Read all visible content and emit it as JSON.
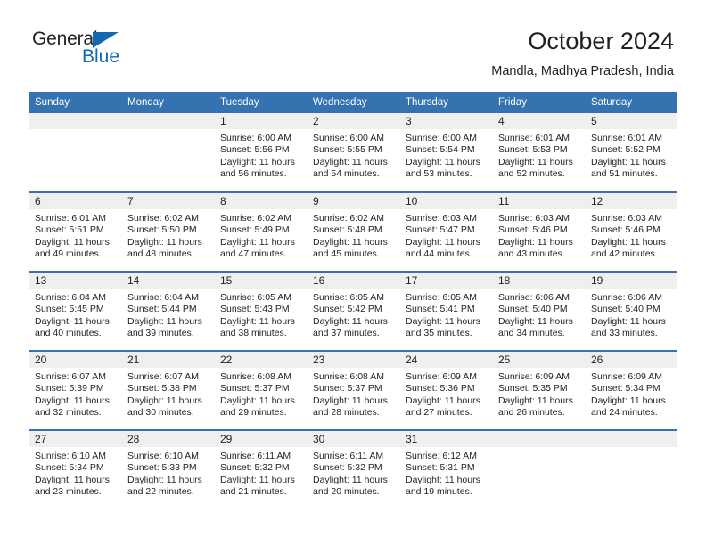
{
  "brand": {
    "name_part1": "General",
    "name_part2": "Blue",
    "accent_color": "#1268b3"
  },
  "header": {
    "month_title": "October 2024",
    "location": "Mandla, Madhya Pradesh, India"
  },
  "theme": {
    "header_blue": "#3572b0",
    "day_band_gray": "#efefef",
    "text_color": "#231f20"
  },
  "calendar": {
    "weekdays": [
      "Sunday",
      "Monday",
      "Tuesday",
      "Wednesday",
      "Thursday",
      "Friday",
      "Saturday"
    ],
    "weeks": [
      [
        {
          "day": "",
          "lines": []
        },
        {
          "day": "",
          "lines": []
        },
        {
          "day": "1",
          "lines": [
            "Sunrise: 6:00 AM",
            "Sunset: 5:56 PM",
            "Daylight: 11 hours",
            "and 56 minutes."
          ]
        },
        {
          "day": "2",
          "lines": [
            "Sunrise: 6:00 AM",
            "Sunset: 5:55 PM",
            "Daylight: 11 hours",
            "and 54 minutes."
          ]
        },
        {
          "day": "3",
          "lines": [
            "Sunrise: 6:00 AM",
            "Sunset: 5:54 PM",
            "Daylight: 11 hours",
            "and 53 minutes."
          ]
        },
        {
          "day": "4",
          "lines": [
            "Sunrise: 6:01 AM",
            "Sunset: 5:53 PM",
            "Daylight: 11 hours",
            "and 52 minutes."
          ]
        },
        {
          "day": "5",
          "lines": [
            "Sunrise: 6:01 AM",
            "Sunset: 5:52 PM",
            "Daylight: 11 hours",
            "and 51 minutes."
          ]
        }
      ],
      [
        {
          "day": "6",
          "lines": [
            "Sunrise: 6:01 AM",
            "Sunset: 5:51 PM",
            "Daylight: 11 hours",
            "and 49 minutes."
          ]
        },
        {
          "day": "7",
          "lines": [
            "Sunrise: 6:02 AM",
            "Sunset: 5:50 PM",
            "Daylight: 11 hours",
            "and 48 minutes."
          ]
        },
        {
          "day": "8",
          "lines": [
            "Sunrise: 6:02 AM",
            "Sunset: 5:49 PM",
            "Daylight: 11 hours",
            "and 47 minutes."
          ]
        },
        {
          "day": "9",
          "lines": [
            "Sunrise: 6:02 AM",
            "Sunset: 5:48 PM",
            "Daylight: 11 hours",
            "and 45 minutes."
          ]
        },
        {
          "day": "10",
          "lines": [
            "Sunrise: 6:03 AM",
            "Sunset: 5:47 PM",
            "Daylight: 11 hours",
            "and 44 minutes."
          ]
        },
        {
          "day": "11",
          "lines": [
            "Sunrise: 6:03 AM",
            "Sunset: 5:46 PM",
            "Daylight: 11 hours",
            "and 43 minutes."
          ]
        },
        {
          "day": "12",
          "lines": [
            "Sunrise: 6:03 AM",
            "Sunset: 5:46 PM",
            "Daylight: 11 hours",
            "and 42 minutes."
          ]
        }
      ],
      [
        {
          "day": "13",
          "lines": [
            "Sunrise: 6:04 AM",
            "Sunset: 5:45 PM",
            "Daylight: 11 hours",
            "and 40 minutes."
          ]
        },
        {
          "day": "14",
          "lines": [
            "Sunrise: 6:04 AM",
            "Sunset: 5:44 PM",
            "Daylight: 11 hours",
            "and 39 minutes."
          ]
        },
        {
          "day": "15",
          "lines": [
            "Sunrise: 6:05 AM",
            "Sunset: 5:43 PM",
            "Daylight: 11 hours",
            "and 38 minutes."
          ]
        },
        {
          "day": "16",
          "lines": [
            "Sunrise: 6:05 AM",
            "Sunset: 5:42 PM",
            "Daylight: 11 hours",
            "and 37 minutes."
          ]
        },
        {
          "day": "17",
          "lines": [
            "Sunrise: 6:05 AM",
            "Sunset: 5:41 PM",
            "Daylight: 11 hours",
            "and 35 minutes."
          ]
        },
        {
          "day": "18",
          "lines": [
            "Sunrise: 6:06 AM",
            "Sunset: 5:40 PM",
            "Daylight: 11 hours",
            "and 34 minutes."
          ]
        },
        {
          "day": "19",
          "lines": [
            "Sunrise: 6:06 AM",
            "Sunset: 5:40 PM",
            "Daylight: 11 hours",
            "and 33 minutes."
          ]
        }
      ],
      [
        {
          "day": "20",
          "lines": [
            "Sunrise: 6:07 AM",
            "Sunset: 5:39 PM",
            "Daylight: 11 hours",
            "and 32 minutes."
          ]
        },
        {
          "day": "21",
          "lines": [
            "Sunrise: 6:07 AM",
            "Sunset: 5:38 PM",
            "Daylight: 11 hours",
            "and 30 minutes."
          ]
        },
        {
          "day": "22",
          "lines": [
            "Sunrise: 6:08 AM",
            "Sunset: 5:37 PM",
            "Daylight: 11 hours",
            "and 29 minutes."
          ]
        },
        {
          "day": "23",
          "lines": [
            "Sunrise: 6:08 AM",
            "Sunset: 5:37 PM",
            "Daylight: 11 hours",
            "and 28 minutes."
          ]
        },
        {
          "day": "24",
          "lines": [
            "Sunrise: 6:09 AM",
            "Sunset: 5:36 PM",
            "Daylight: 11 hours",
            "and 27 minutes."
          ]
        },
        {
          "day": "25",
          "lines": [
            "Sunrise: 6:09 AM",
            "Sunset: 5:35 PM",
            "Daylight: 11 hours",
            "and 26 minutes."
          ]
        },
        {
          "day": "26",
          "lines": [
            "Sunrise: 6:09 AM",
            "Sunset: 5:34 PM",
            "Daylight: 11 hours",
            "and 24 minutes."
          ]
        }
      ],
      [
        {
          "day": "27",
          "lines": [
            "Sunrise: 6:10 AM",
            "Sunset: 5:34 PM",
            "Daylight: 11 hours",
            "and 23 minutes."
          ]
        },
        {
          "day": "28",
          "lines": [
            "Sunrise: 6:10 AM",
            "Sunset: 5:33 PM",
            "Daylight: 11 hours",
            "and 22 minutes."
          ]
        },
        {
          "day": "29",
          "lines": [
            "Sunrise: 6:11 AM",
            "Sunset: 5:32 PM",
            "Daylight: 11 hours",
            "and 21 minutes."
          ]
        },
        {
          "day": "30",
          "lines": [
            "Sunrise: 6:11 AM",
            "Sunset: 5:32 PM",
            "Daylight: 11 hours",
            "and 20 minutes."
          ]
        },
        {
          "day": "31",
          "lines": [
            "Sunrise: 6:12 AM",
            "Sunset: 5:31 PM",
            "Daylight: 11 hours",
            "and 19 minutes."
          ]
        },
        {
          "day": "",
          "lines": []
        },
        {
          "day": "",
          "lines": []
        }
      ]
    ]
  }
}
